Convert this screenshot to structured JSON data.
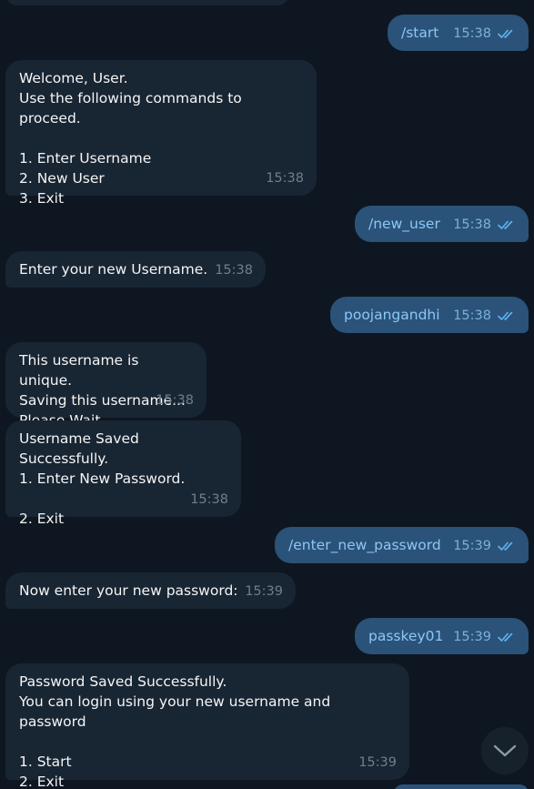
{
  "colors": {
    "background": "#0e1621",
    "incoming_bubble": "#182533",
    "outgoing_bubble": "#2b5278",
    "outgoing_text": "#8cc7f7",
    "read_check": "#5fb0ed"
  },
  "messages": [
    {
      "direction": "out",
      "text": "/start",
      "time": "15:38",
      "status": "read"
    },
    {
      "direction": "in",
      "text": "Welcome, User.\nUse the following commands to proceed.\n\n1. Enter Username\n2. New User\n3. Exit",
      "time": "15:38"
    },
    {
      "direction": "out",
      "text": "/new_user",
      "time": "15:38",
      "status": "read"
    },
    {
      "direction": "in",
      "text": "Enter your new Username.",
      "time": "15:38"
    },
    {
      "direction": "out",
      "text": "poojangandhi",
      "time": "15:38",
      "status": "read"
    },
    {
      "direction": "in",
      "text": "This username is unique.\nSaving this username...\nPlease Wait...",
      "time": "15:38"
    },
    {
      "direction": "in",
      "text": "Username Saved Successfully.\n1. Enter New Password.\n\n2. Exit",
      "time": "15:38"
    },
    {
      "direction": "out",
      "text": "/enter_new_password",
      "time": "15:39",
      "status": "read"
    },
    {
      "direction": "in",
      "text": "Now enter your new password:",
      "time": "15:39"
    },
    {
      "direction": "out",
      "text": "passkey01",
      "time": "15:39",
      "status": "read"
    },
    {
      "direction": "in",
      "text": "Password Saved Successfully.\nYou can login using your new username and password\n\n1. Start\n2. Exit",
      "time": "15:39"
    }
  ],
  "scroll_button": {
    "icon": "chevron-down-icon"
  }
}
